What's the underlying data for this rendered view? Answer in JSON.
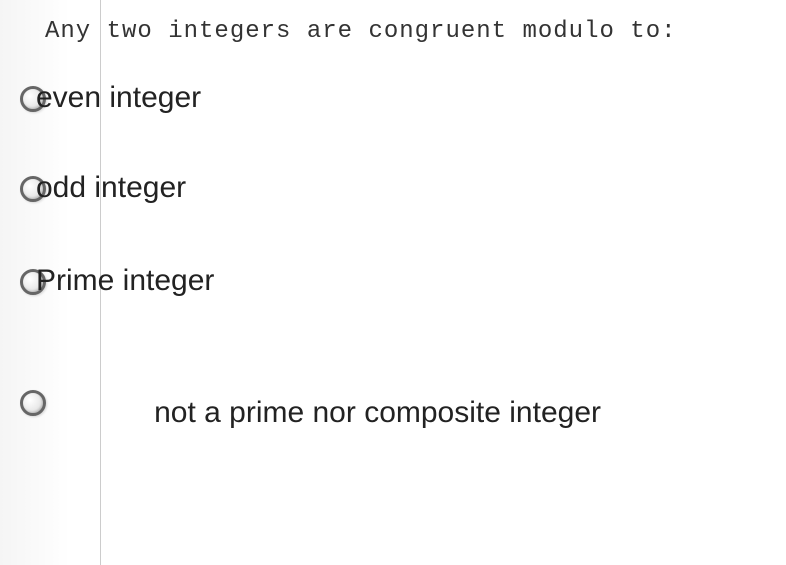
{
  "question": {
    "text": "Any two integers are congruent modulo to:"
  },
  "options": [
    {
      "label": "even integer"
    },
    {
      "label": "odd integer"
    },
    {
      "label": "Prime integer"
    },
    {
      "label": "not a prime nor composite integer"
    }
  ]
}
